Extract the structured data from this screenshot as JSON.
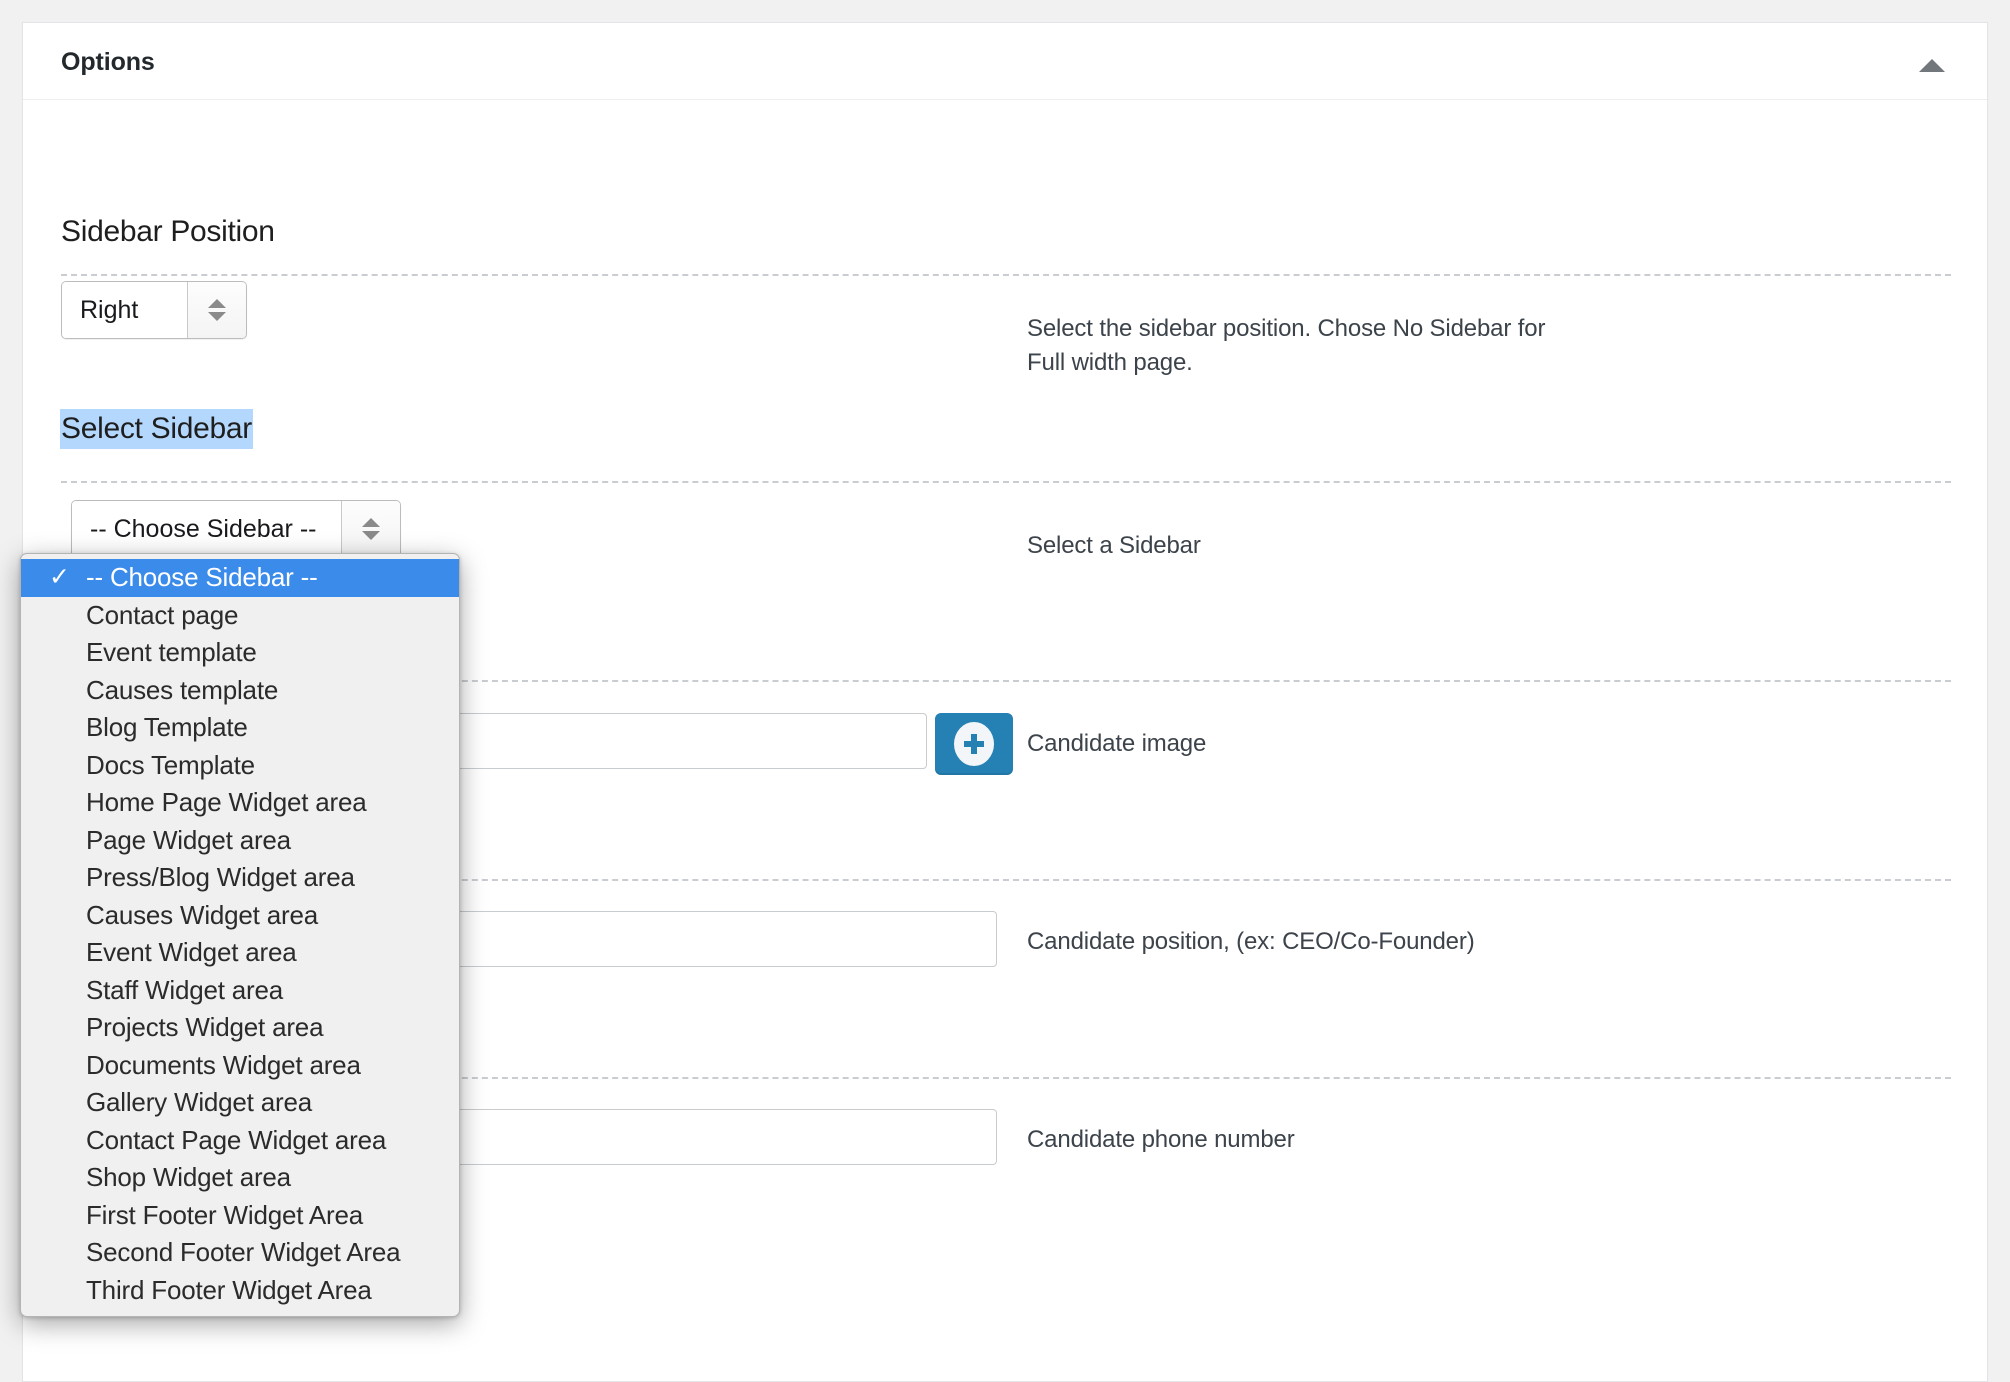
{
  "panel": {
    "title": "Options",
    "toggle_icon": "triangle-up-icon"
  },
  "sections": [
    {
      "id": "sidebar-position",
      "heading": "Sidebar Position",
      "control": {
        "type": "select",
        "value": "Right"
      },
      "help": "Select the sidebar position. Chose No Sidebar for Full width page."
    },
    {
      "id": "select-sidebar",
      "heading": "Select Sidebar",
      "highlighted": true,
      "control": {
        "type": "select",
        "value": "-- Choose Sidebar --"
      },
      "help": "Select a Sidebar"
    },
    {
      "id": "candidate-image",
      "heading": "",
      "control": {
        "type": "media",
        "value": "",
        "button_icon": "plus-circle-icon"
      },
      "help": "Candidate image"
    },
    {
      "id": "candidate-position",
      "heading": "",
      "control": {
        "type": "text",
        "value": ""
      },
      "help": "Candidate position, (ex: CEO/Co-Founder)"
    },
    {
      "id": "candidate-phone",
      "heading": "",
      "control": {
        "type": "text",
        "value": ""
      },
      "help": "Candidate phone number"
    }
  ],
  "dropdown": {
    "open": true,
    "selected_index": 0,
    "check_glyph": "✓",
    "items": [
      "-- Choose Sidebar --",
      "Contact page",
      "Event template",
      "Causes template",
      "Blog Template",
      "Docs Template",
      "Home Page Widget area",
      "Page Widget area",
      "Press/Blog Widget area",
      "Causes Widget area",
      "Event Widget area",
      "Staff Widget area",
      "Projects Widget area",
      "Documents Widget area",
      "Gallery Widget area",
      "Contact Page Widget area",
      "Shop Widget area",
      "First Footer Widget Area",
      "Second Footer Widget Area",
      "Third Footer Widget Area"
    ]
  },
  "colors": {
    "page_background": "#f1f1f1",
    "panel_background": "#ffffff",
    "panel_border": "#e2e4e7",
    "heading_text": "#1e1e1e",
    "help_text": "#3c434a",
    "highlight_selection": "#b3d7fd",
    "dropdown_selected": "#3b8beb",
    "dropdown_background": "#f0f0f0",
    "upload_button": "#2580b4",
    "separator": "#c9cdd1",
    "toggle_arrow": "#72777c"
  }
}
